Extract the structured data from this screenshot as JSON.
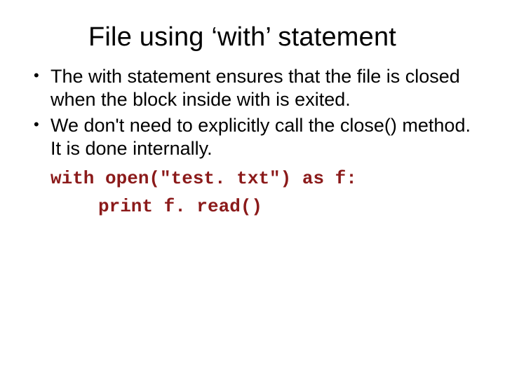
{
  "title": "File using ‘with’ statement",
  "bullets": [
    "The with statement ensures that the file is  closed when the block inside with is exited.",
    "We don't need to explicitly call the close()  method. It is done internally."
  ],
  "code": {
    "line1": "with open(\"test. txt\") as f:",
    "line2": "print f. read()"
  }
}
